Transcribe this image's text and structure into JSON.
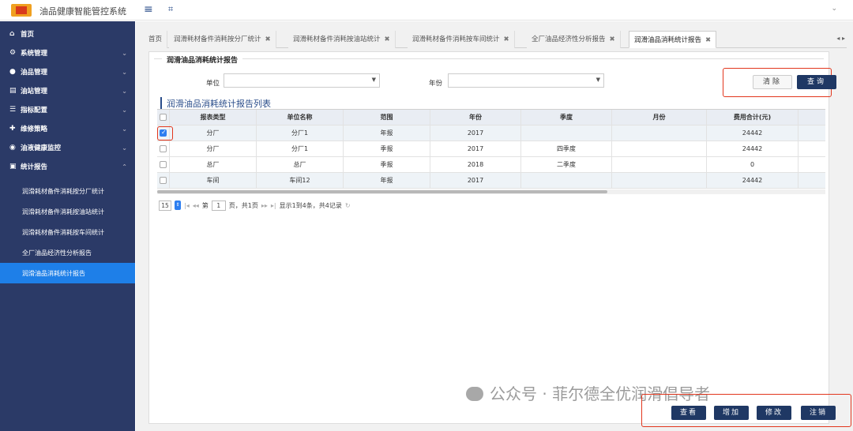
{
  "header": {
    "app_title": "油品健康智能管控系统",
    "menu_icon": "hamburger-menu-icon",
    "fullscreen_icon": "fullscreen-icon"
  },
  "sidebar": {
    "items": [
      {
        "label": "首页",
        "icon": "home-icon"
      },
      {
        "label": "系统管理",
        "icon": "gear-icon"
      },
      {
        "label": "油品管理",
        "icon": "droplet-icon"
      },
      {
        "label": "油站管理",
        "icon": "station-icon"
      },
      {
        "label": "指标配置",
        "icon": "sliders-icon"
      },
      {
        "label": "维修策略",
        "icon": "wrench-icon"
      },
      {
        "label": "油液健康监控",
        "icon": "monitor-icon"
      },
      {
        "label": "统计报告",
        "icon": "report-icon"
      }
    ],
    "sub_items": [
      {
        "label": "润滑耗材备件消耗按分厂统计"
      },
      {
        "label": "润滑耗材备件消耗按油站统计"
      },
      {
        "label": "润滑耗材备件消耗按车间统计"
      },
      {
        "label": "全厂油品经济性分析报告"
      },
      {
        "label": "润滑油品消耗统计报告"
      }
    ]
  },
  "tabs": [
    {
      "label": "首页"
    },
    {
      "label": "润滑耗材备件消耗按分厂统计"
    },
    {
      "label": "润滑耗材备件消耗按油站统计"
    },
    {
      "label": "润滑耗材备件消耗按车间统计"
    },
    {
      "label": "全厂油品经济性分析报告"
    },
    {
      "label": "润滑油品消耗统计报告"
    }
  ],
  "filter": {
    "legend": "润滑油品消耗统计报告",
    "unit_label": "单位",
    "unit_value": "",
    "year_label": "年份",
    "year_value": "",
    "clear_label": "清除",
    "query_label": "查询"
  },
  "list": {
    "title": "润滑油品消耗统计报告列表",
    "columns": [
      "报表类型",
      "单位名称",
      "范围",
      "年份",
      "季度",
      "月份",
      "费用合计(元)"
    ],
    "rows": [
      {
        "checked": true,
        "cells": [
          "分厂",
          "分厂1",
          "年报",
          "2017",
          "",
          "",
          "24442"
        ]
      },
      {
        "checked": false,
        "cells": [
          "分厂",
          "分厂1",
          "季报",
          "2017",
          "四季度",
          "",
          "24442"
        ]
      },
      {
        "checked": false,
        "cells": [
          "总厂",
          "总厂",
          "季报",
          "2018",
          "二季度",
          "",
          "0"
        ]
      },
      {
        "checked": false,
        "cells": [
          "车间",
          "车间12",
          "年报",
          "2017",
          "",
          "",
          "24442"
        ]
      }
    ]
  },
  "pager": {
    "page_size": "15",
    "page_prefix": "第",
    "current_page": "1",
    "page_suffix": "页，共1页",
    "summary": "显示1到4条，共4记录"
  },
  "watermark": {
    "text": "公众号 · 菲尔德全优润滑倡导者"
  },
  "actions": {
    "view": "查看",
    "add": "增加",
    "edit": "修改",
    "cancel": "注销"
  },
  "colors": {
    "sidebar_bg": "#2b3a67",
    "active": "#1e7fe8",
    "primary_btn": "#1f3864",
    "highlight": "#e2361d"
  }
}
